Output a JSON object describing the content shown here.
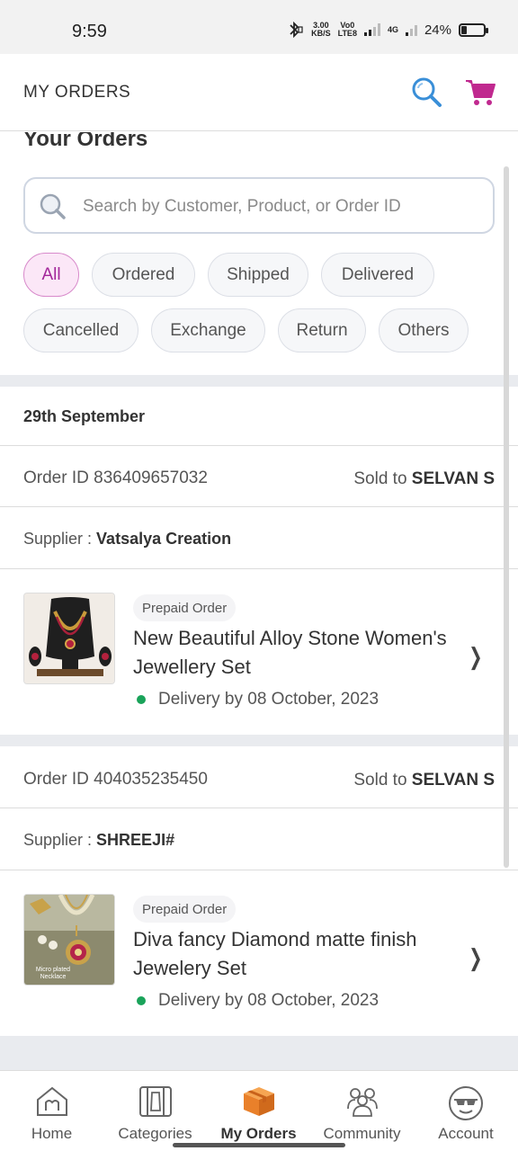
{
  "status_bar": {
    "time": "9:59",
    "net_speed_top": "3.00",
    "net_speed_bottom": "KB/S",
    "volte_top": "Vo0",
    "volte_bottom": "LTE8",
    "network": "4G",
    "battery": "24%",
    "battery_level": 0.24
  },
  "header": {
    "title": "MY ORDERS",
    "search_icon": "search-icon",
    "cart_icon": "cart-icon"
  },
  "section_title": "Your Orders",
  "search": {
    "placeholder": "Search by Customer, Product, or Order ID"
  },
  "filters": [
    {
      "label": "All",
      "active": true
    },
    {
      "label": "Ordered",
      "active": false
    },
    {
      "label": "Shipped",
      "active": false
    },
    {
      "label": "Delivered",
      "active": false
    },
    {
      "label": "Cancelled",
      "active": false
    },
    {
      "label": "Exchange",
      "active": false
    },
    {
      "label": "Return",
      "active": false
    },
    {
      "label": "Others",
      "active": false
    }
  ],
  "date_group": "29th September",
  "orders": [
    {
      "order_id": "Order ID 836409657032",
      "sold_to_label": "Sold to ",
      "sold_to_name": "SELVAN S",
      "supplier_label": "Supplier : ",
      "supplier_name": "Vatsalya Creation",
      "badge": "Prepaid Order",
      "product_name": "New Beautiful Alloy Stone Women's Jewellery Set",
      "delivery": "Delivery by 08 October, 2023",
      "thumb_caption": ""
    },
    {
      "order_id": "Order ID 404035235450",
      "sold_to_label": "Sold to ",
      "sold_to_name": "SELVAN S",
      "supplier_label": "Supplier : ",
      "supplier_name": "SHREEJI#",
      "badge": "Prepaid Order",
      "product_name": "Diva fancy Diamond matte finish Jewelery Set",
      "delivery": "Delivery by 08 October, 2023",
      "thumb_caption": "Micro plated Necklace"
    }
  ],
  "bottom_nav": [
    {
      "label": "Home",
      "icon": "home-icon",
      "active": false
    },
    {
      "label": "Categories",
      "icon": "categories-icon",
      "active": false
    },
    {
      "label": "My Orders",
      "icon": "orders-box-icon",
      "active": true
    },
    {
      "label": "Community",
      "icon": "community-icon",
      "active": false
    },
    {
      "label": "Account",
      "icon": "account-icon",
      "active": false
    }
  ],
  "colors": {
    "accent": "#a3269a",
    "cart": "#c0298f",
    "search_icon": "#3a8fd8",
    "delivery_dot": "#1aa35a",
    "orders_icon": "#f08a2c"
  }
}
